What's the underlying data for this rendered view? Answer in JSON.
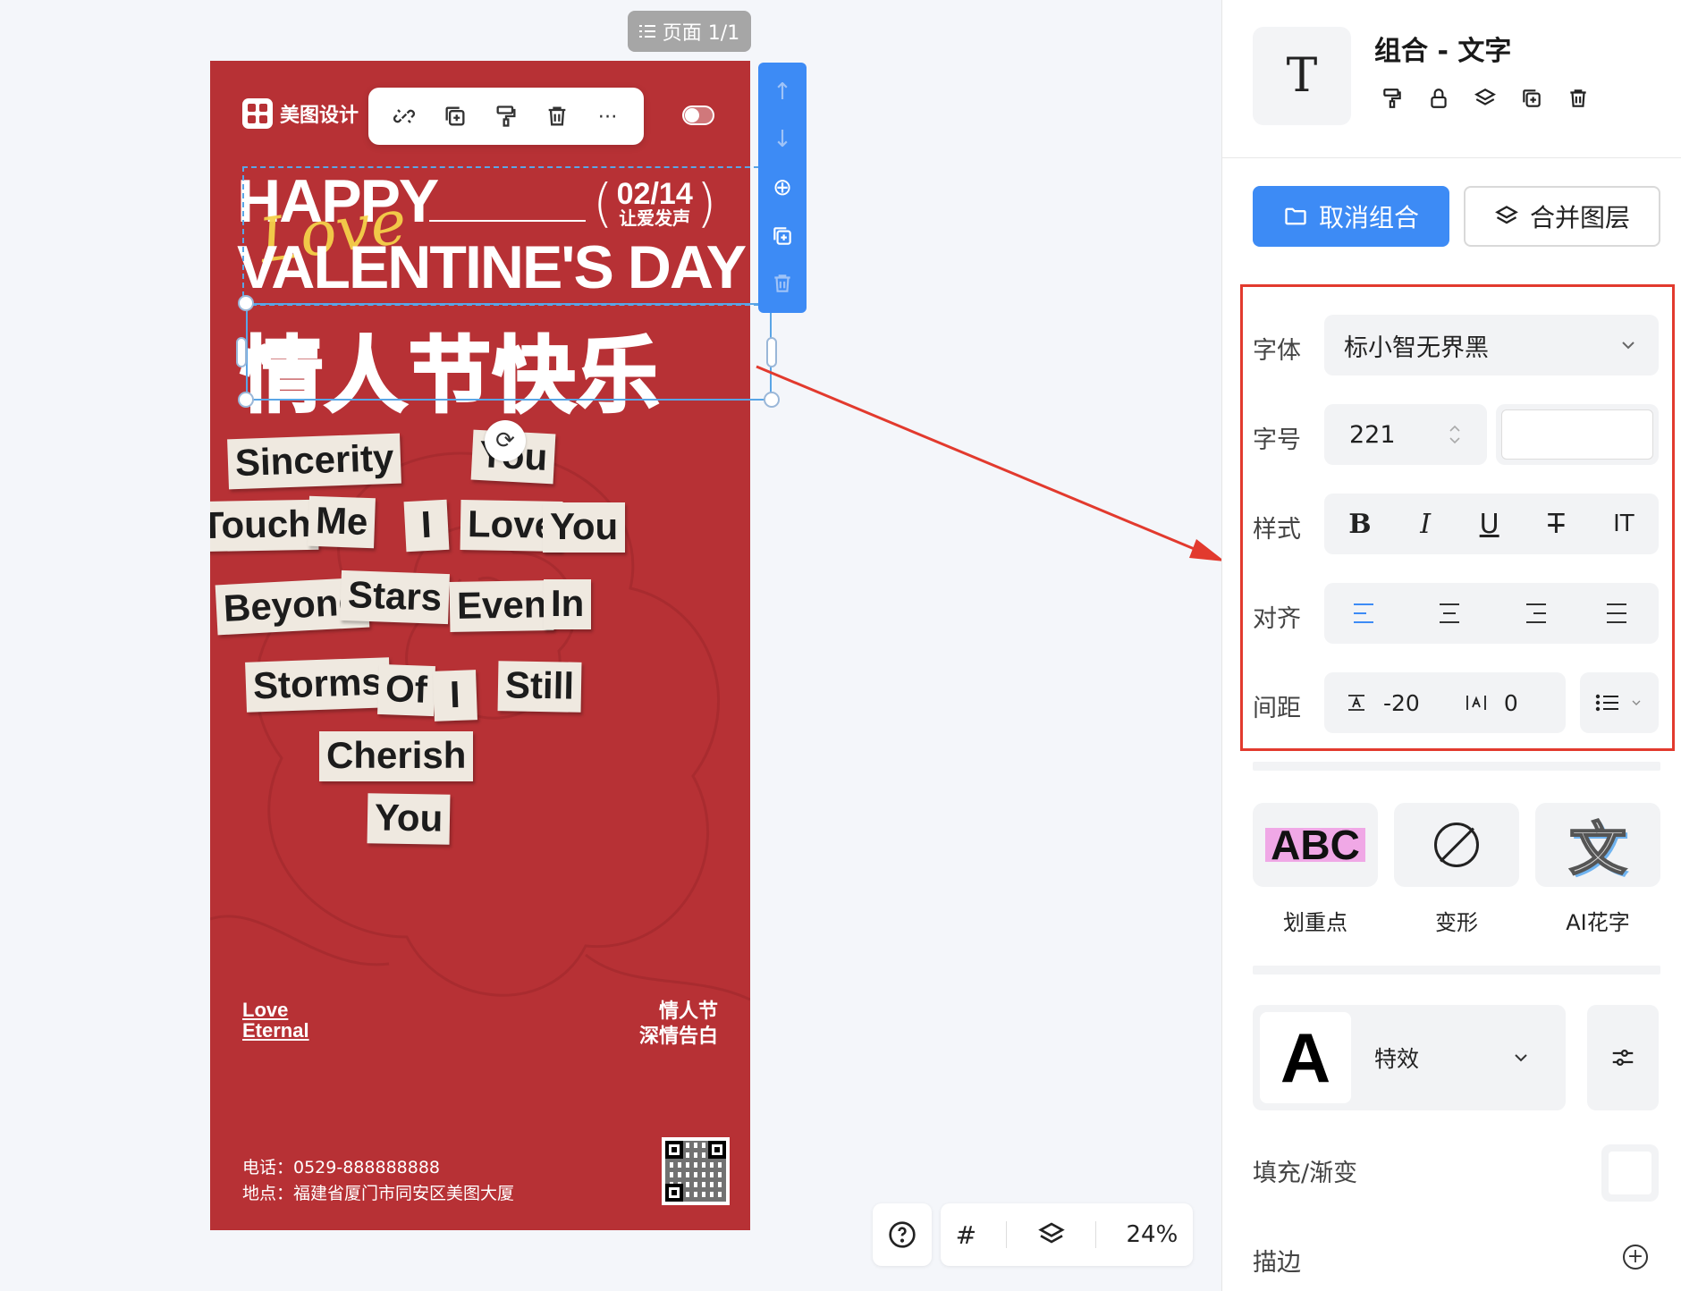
{
  "page_indicator": "页面 1/1",
  "poster": {
    "brand": "美图设计",
    "happy": "HAPPY",
    "date": "02/14",
    "date_sub": "让爱发声",
    "love_script": "Love",
    "valentine": "VALENTINE'S DAY",
    "cn_title": "情人节快乐",
    "words": [
      "Sincerity",
      "You",
      "Touch",
      "Me",
      "I",
      "Love",
      "You",
      "Beyond",
      "Stars",
      "Even",
      "In",
      "Storms",
      "Of",
      "I",
      "Still",
      "Cherish",
      "You"
    ],
    "love_eternal_1": "Love",
    "love_eternal_2": "Eternal",
    "cn_sub_1": "情人节",
    "cn_sub_2": "深情告白",
    "phone": "电话：0529-888888888",
    "address": "地点：福建省厦门市同安区美图大厦"
  },
  "bottom_bar": {
    "zoom": "24%",
    "icons": [
      "help-icon",
      "grid-icon",
      "layers-icon"
    ]
  },
  "panel": {
    "title": "组合 - 文字",
    "ungroup_label": "取消组合",
    "merge_label": "合并图层",
    "font_label": "字体",
    "font_value": "标小智无界黑",
    "size_label": "字号",
    "size_value": "221",
    "style_label": "样式",
    "align_label": "对齐",
    "spacing_label": "间距",
    "letter_spacing": "-20",
    "line_spacing": "0",
    "fx": {
      "highlight_label": "划重点",
      "warp_label": "变形",
      "ai_label": "AI花字",
      "abc": "ABC",
      "ai_char": "文"
    },
    "effect_swatch": "A",
    "effect_label": "特效",
    "fill_label": "填充/渐变",
    "stroke_label": "描边"
  },
  "colors": {
    "poster_bg": "#b73135",
    "accent": "#3d8bf5",
    "annotation": "#e23a2e"
  }
}
